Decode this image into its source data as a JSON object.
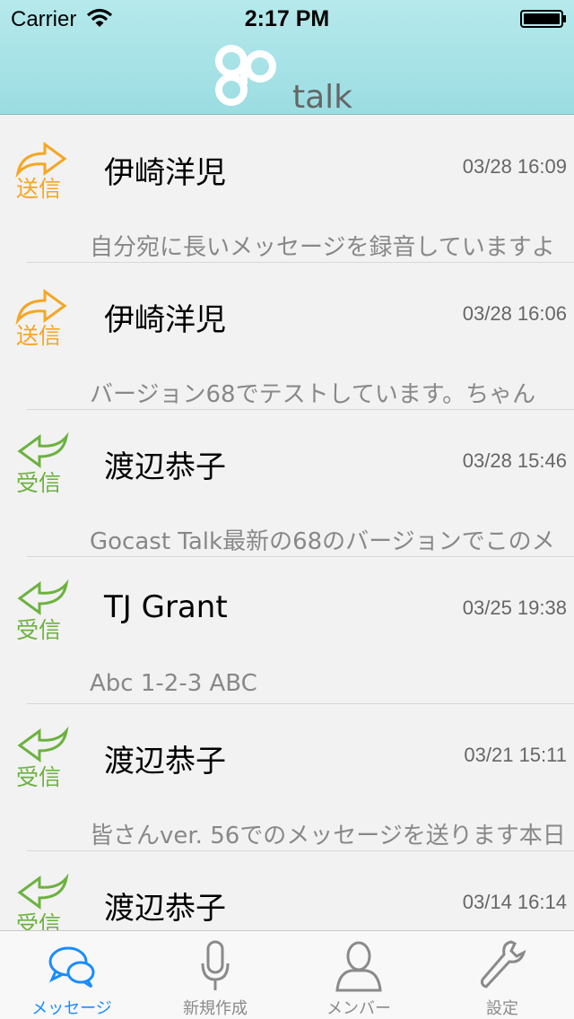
{
  "status_bar": {
    "carrier": "Carrier",
    "time": "2:17 PM"
  },
  "header": {
    "logo_text": "go",
    "logo_sub": "talk"
  },
  "messages": [
    {
      "direction": "sent",
      "direction_label": "送信",
      "name": "伊崎洋児",
      "date": "03/28 16:09",
      "preview": "自分宛に長いメッセージを録音していますよ"
    },
    {
      "direction": "sent",
      "direction_label": "送信",
      "name": "伊崎洋児",
      "date": "03/28 16:06",
      "preview": "バージョン68でテストしています。ちゃん"
    },
    {
      "direction": "recv",
      "direction_label": "受信",
      "name": "渡辺恭子",
      "date": "03/28 15:46",
      "preview": "Gocast Talk最新の68のバージョンでこのメ"
    },
    {
      "direction": "recv",
      "direction_label": "受信",
      "name": "TJ Grant",
      "date": "03/25 19:38",
      "preview": "Abc 1-2-3 ABC"
    },
    {
      "direction": "recv",
      "direction_label": "受信",
      "name": "渡辺恭子",
      "date": "03/21 15:11",
      "preview": "皆さんver. 56でのメッセージを送ります本日"
    },
    {
      "direction": "recv",
      "direction_label": "受信",
      "name": "渡辺恭子",
      "date": "03/14 16:14",
      "preview": ""
    }
  ],
  "tabbar": {
    "tabs": [
      {
        "label": "メッセージ",
        "icon": "chat-bubbles-icon",
        "active": true
      },
      {
        "label": "新規作成",
        "icon": "microphone-icon",
        "active": false
      },
      {
        "label": "メンバー",
        "icon": "person-icon",
        "active": false
      },
      {
        "label": "設定",
        "icon": "wrench-icon",
        "active": false
      }
    ]
  },
  "colors": {
    "sent": "#f5a623",
    "received": "#6cb23f",
    "accent": "#1a8cff",
    "header": "#a8e2e6"
  }
}
